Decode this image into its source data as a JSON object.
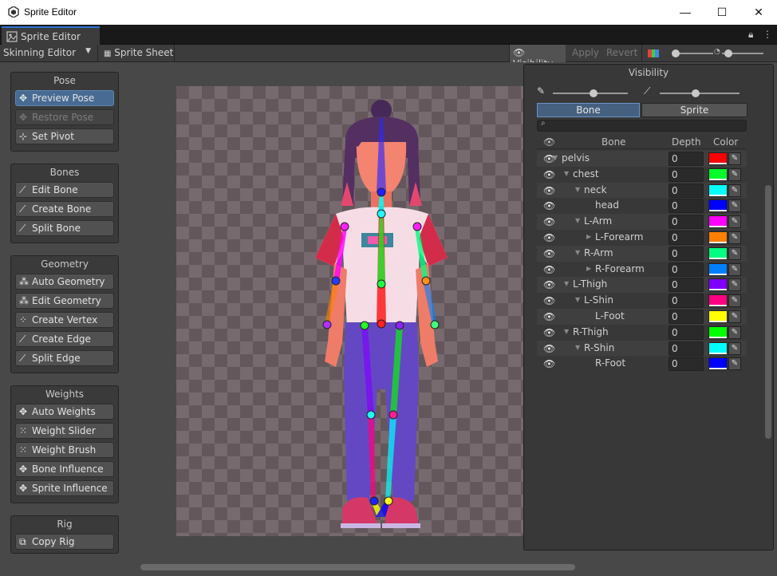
{
  "window": {
    "title": "Sprite Editor",
    "controls": {
      "minimize": "—",
      "maximize": "☐",
      "close": "✕"
    }
  },
  "tab": {
    "label": "Sprite Editor"
  },
  "toolbar": {
    "mode": "Skinning Editor",
    "sprite_sheet": "Sprite Sheet",
    "visibility": "Visibility",
    "apply": "Apply",
    "revert": "Revert"
  },
  "groups": {
    "pose": {
      "title": "Pose",
      "buttons": [
        "Preview Pose",
        "Restore Pose",
        "Set Pivot"
      ]
    },
    "bones": {
      "title": "Bones",
      "buttons": [
        "Edit Bone",
        "Create Bone",
        "Split Bone"
      ]
    },
    "geometry": {
      "title": "Geometry",
      "buttons": [
        "Auto Geometry",
        "Edit Geometry",
        "Create Vertex",
        "Create Edge",
        "Split Edge"
      ]
    },
    "weights": {
      "title": "Weights",
      "buttons": [
        "Auto Weights",
        "Weight Slider",
        "Weight Brush",
        "Bone Influence",
        "Sprite Influence"
      ]
    },
    "rig": {
      "title": "Rig",
      "buttons": [
        "Copy Rig"
      ]
    }
  },
  "visibility_panel": {
    "title": "Visibility",
    "tabs": [
      "Bone",
      "Sprite"
    ],
    "search_placeholder": "",
    "columns": [
      "Bone",
      "Depth",
      "Color"
    ],
    "rows": [
      {
        "name": "pelvis",
        "depth": "0",
        "color": "#ff0000",
        "level": 0,
        "arrow": "▼"
      },
      {
        "name": "chest",
        "depth": "0",
        "color": "#00ff2a",
        "level": 1,
        "arrow": "▼"
      },
      {
        "name": "neck",
        "depth": "0",
        "color": "#00ffff",
        "level": 2,
        "arrow": "▼"
      },
      {
        "name": "head",
        "depth": "0",
        "color": "#0000ff",
        "level": 3,
        "arrow": ""
      },
      {
        "name": "L-Arm",
        "depth": "0",
        "color": "#ff00ff",
        "level": 2,
        "arrow": "▼"
      },
      {
        "name": "L-Forearm",
        "depth": "0",
        "color": "#ff8000",
        "level": 3,
        "arrow": "▶"
      },
      {
        "name": "R-Arm",
        "depth": "0",
        "color": "#00ff80",
        "level": 2,
        "arrow": "▼"
      },
      {
        "name": "R-Forearm",
        "depth": "0",
        "color": "#0080ff",
        "level": 3,
        "arrow": "▶"
      },
      {
        "name": "L-Thigh",
        "depth": "0",
        "color": "#8000ff",
        "level": 1,
        "arrow": "▼"
      },
      {
        "name": "L-Shin",
        "depth": "0",
        "color": "#ff0080",
        "level": 2,
        "arrow": "▼"
      },
      {
        "name": "L-Foot",
        "depth": "0",
        "color": "#ffff00",
        "level": 3,
        "arrow": ""
      },
      {
        "name": "R-Thigh",
        "depth": "0",
        "color": "#00ff00",
        "level": 1,
        "arrow": "▼"
      },
      {
        "name": "R-Shin",
        "depth": "0",
        "color": "#00ffff",
        "level": 2,
        "arrow": "▼"
      },
      {
        "name": "R-Foot",
        "depth": "0",
        "color": "#0000ff",
        "level": 3,
        "arrow": ""
      }
    ]
  }
}
